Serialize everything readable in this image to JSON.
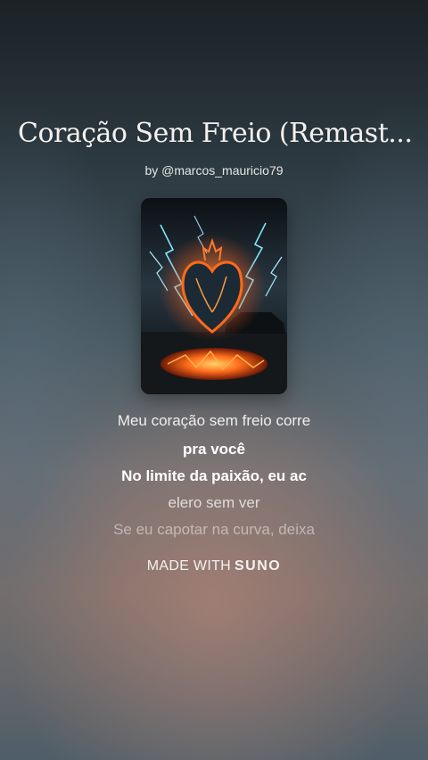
{
  "song": {
    "title": "Coração Sem Freio (Remast...",
    "byline": "by @marcos_mauricio79"
  },
  "cover_art": {
    "icon": "flaming-heart-lightning-cover"
  },
  "lyrics": [
    "Meu coração sem freio corre",
    "pra você",
    "No limite da paixão, eu ac",
    "elero sem ver",
    "Se eu capotar na curva, deixa"
  ],
  "footer": {
    "made_with": "MADE WITH",
    "brand": "SUNO"
  }
}
